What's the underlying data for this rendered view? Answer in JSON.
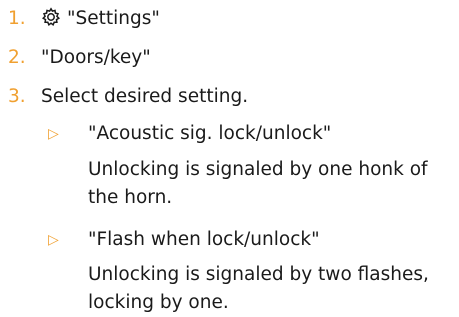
{
  "steps": [
    {
      "number": "1.",
      "text": "\"Settings\"",
      "icon": "gear-icon"
    },
    {
      "number": "2.",
      "text": "\"Doors/key\""
    },
    {
      "number": "3.",
      "text": "Select desired setting."
    }
  ],
  "options": [
    {
      "bullet": "▷",
      "label": "\"Acoustic sig. lock/unlock\"",
      "description": "Unlocking is signaled by one honk of the horn."
    },
    {
      "bullet": "▷",
      "label": "\"Flash when lock/unlock\"",
      "description": "Unlocking is signaled by two flashes, locking by one."
    }
  ],
  "colors": {
    "accent": "#f0a030",
    "text": "#1a1a1a"
  }
}
